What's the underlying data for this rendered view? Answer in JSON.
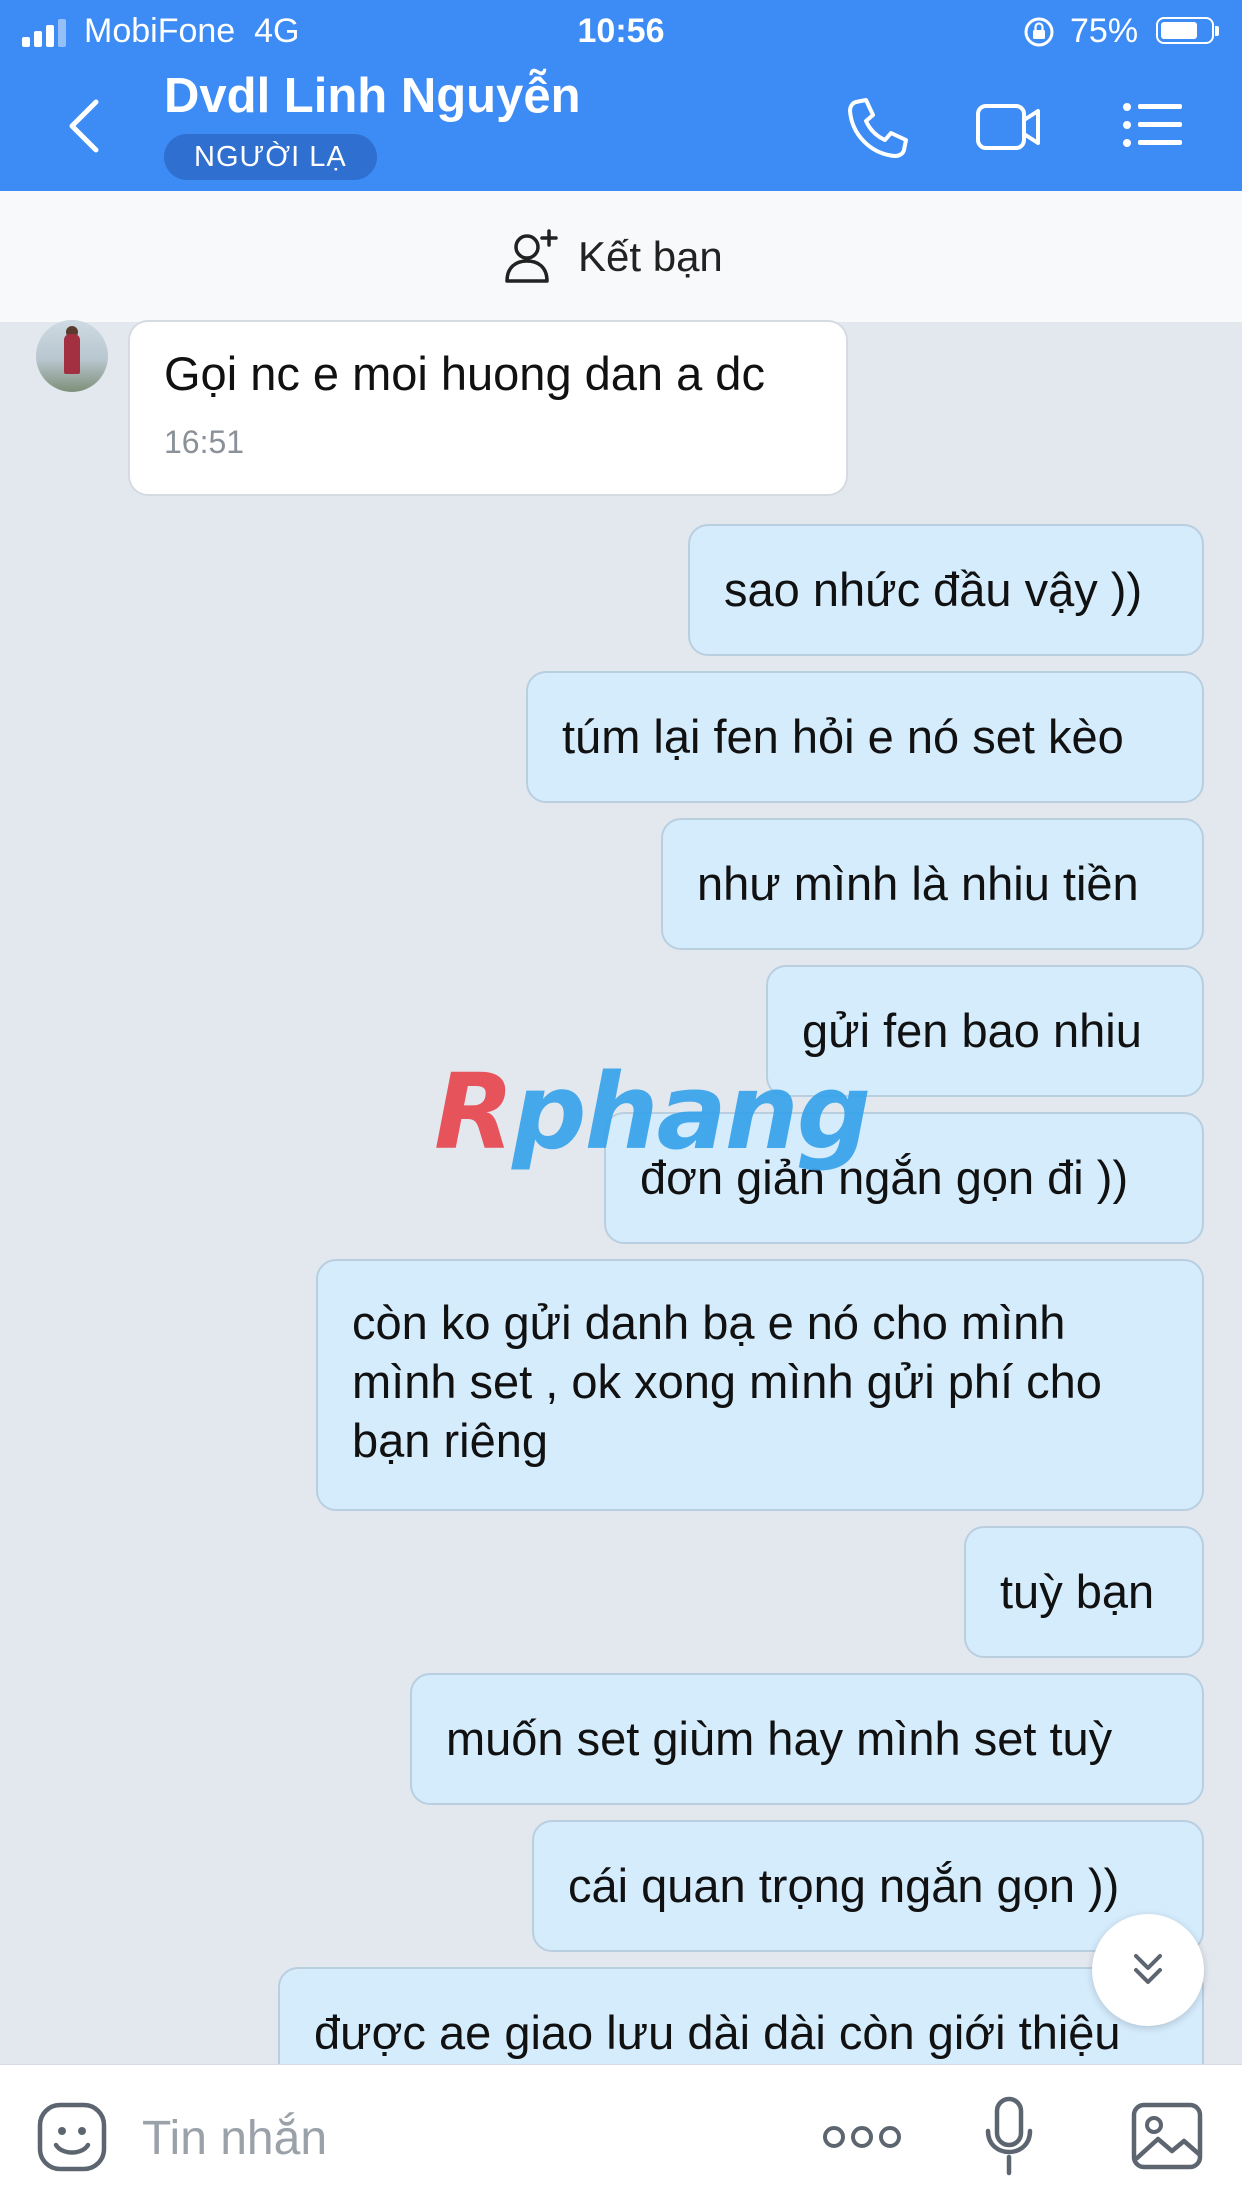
{
  "status_bar": {
    "carrier": "MobiFone",
    "network": "4G",
    "time": "10:56",
    "battery": "75%",
    "battery_level": 0.75
  },
  "header": {
    "contact_name": "Dvdl Linh Nguyễn",
    "badge": "NGƯỜI LẠ",
    "background_color": "#3d8bf5",
    "icons": [
      "back-icon",
      "phone-icon",
      "video-call-icon",
      "menu-icon"
    ]
  },
  "add_friend": {
    "label": "Kết bạn",
    "icon": "add-user-icon"
  },
  "messages": [
    {
      "direction": "in",
      "text": "Gọi nc e moi huong dan a dc",
      "time": "16:51"
    },
    {
      "direction": "out",
      "text": "sao nhức đầu vậy ))"
    },
    {
      "direction": "out",
      "text": "túm lại fen hỏi e nó set kèo"
    },
    {
      "direction": "out",
      "text": "như mình là nhiu tiền"
    },
    {
      "direction": "out",
      "text": "gửi fen bao nhiu"
    },
    {
      "direction": "out",
      "text": "đơn giản ngắn gọn đi ))"
    },
    {
      "direction": "out",
      "text": "còn ko gửi danh bạ e nó cho mình\nmình set , ok xong mình gửi phí cho\nbạn riêng"
    },
    {
      "direction": "out",
      "text": "tuỳ bạn"
    },
    {
      "direction": "out",
      "text": "muốn set giùm hay mình set tuỳ"
    },
    {
      "direction": "out",
      "text": "cái quan trọng ngắn gọn ))"
    },
    {
      "direction": "out",
      "text": "được ae giao lưu dài dài còn giới thiệu"
    }
  ],
  "watermark": {
    "first": "R",
    "rest": "phang"
  },
  "composer": {
    "placeholder": "Tin nhắn",
    "icons": [
      "sticker-icon",
      "more-icon",
      "microphone-icon",
      "image-icon"
    ]
  },
  "scroll_button_icon": "double-chevron-down-icon"
}
